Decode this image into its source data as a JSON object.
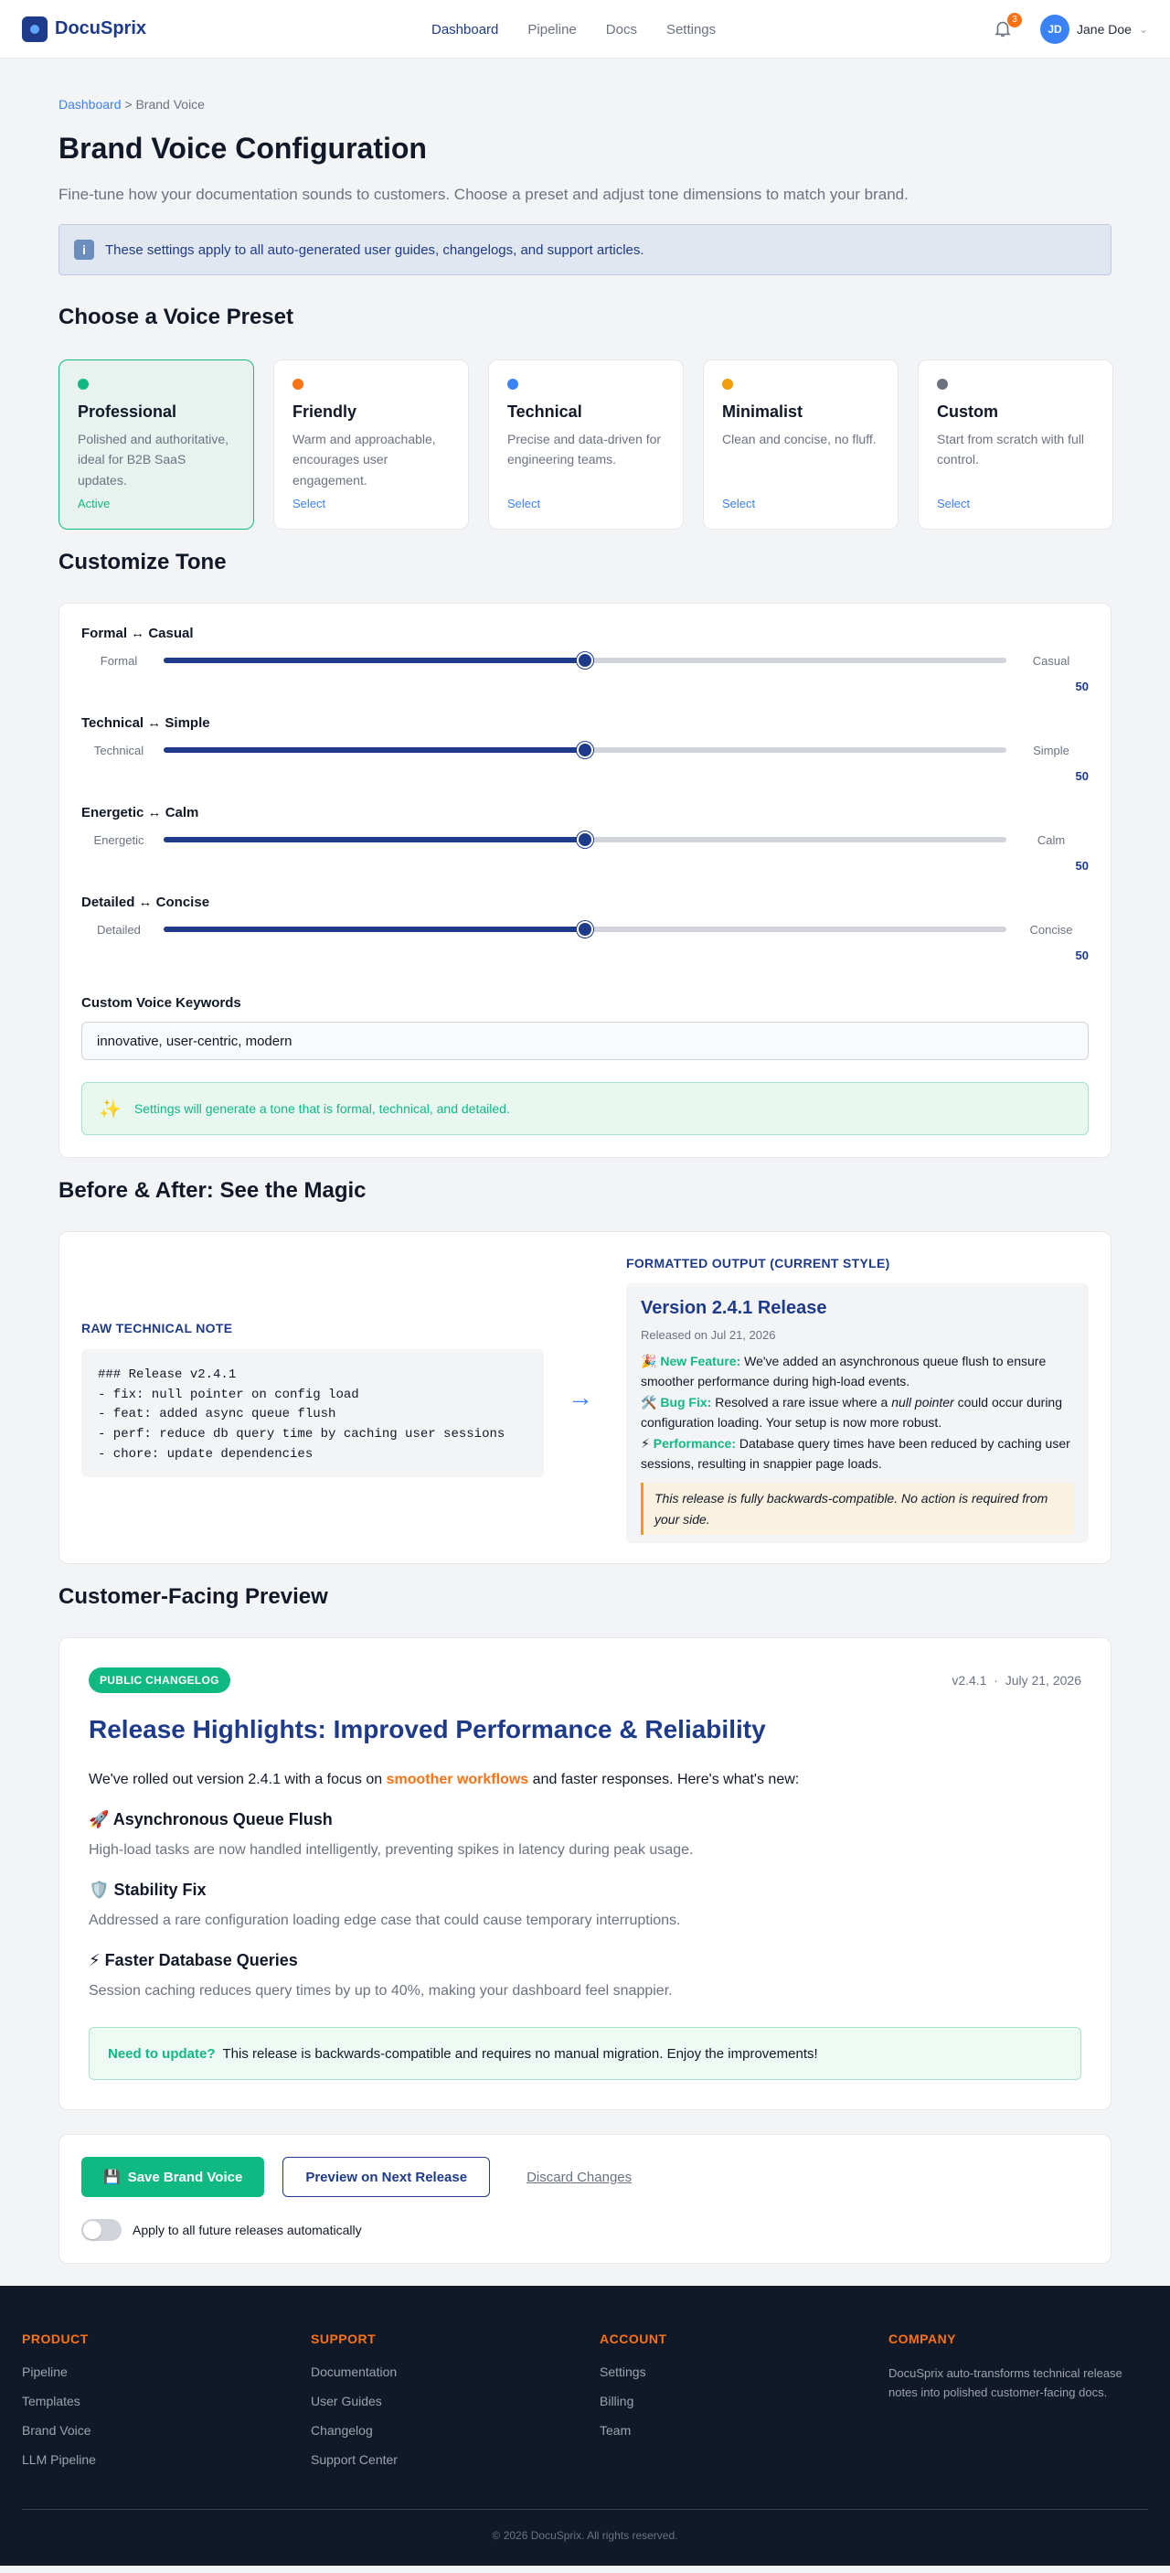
{
  "app": {
    "name": "DocuSprix"
  },
  "nav": {
    "items": [
      "Dashboard",
      "Pipeline",
      "Docs",
      "Settings"
    ],
    "active": "Dashboard"
  },
  "header": {
    "notification_count": "3",
    "user_initials": "JD",
    "user_name": "Jane Doe"
  },
  "breadcrumb": {
    "parent": "Dashboard",
    "separator": " > ",
    "current": "Brand Voice"
  },
  "page": {
    "title": "Brand Voice Configuration",
    "subtitle": "Fine-tune how your documentation sounds to customers. Choose a preset and adjust tone dimensions to match your brand.",
    "info": "These settings apply to all auto-generated user guides, changelogs, and support articles."
  },
  "presets": {
    "title": "Choose a Voice Preset",
    "items": [
      {
        "name": "Professional",
        "desc": "Polished and authoritative, ideal for B2B SaaS updates.",
        "action": "Active",
        "color": "#10b981",
        "active": true
      },
      {
        "name": "Friendly",
        "desc": "Warm and approachable, encourages user engagement.",
        "action": "Select",
        "color": "#f97316",
        "active": false
      },
      {
        "name": "Technical",
        "desc": "Precise and data-driven for engineering teams.",
        "action": "Select",
        "color": "#3b82f6",
        "active": false
      },
      {
        "name": "Minimalist",
        "desc": "Clean and concise, no fluff.",
        "action": "Select",
        "color": "#f59e0b",
        "active": false
      },
      {
        "name": "Custom",
        "desc": "Start from scratch with full control.",
        "action": "Select",
        "color": "#6b7280",
        "active": false
      }
    ]
  },
  "tone": {
    "title": "Customize Tone",
    "sliders": [
      {
        "title": "Formal ↔ Casual",
        "left": "Formal",
        "right": "Casual",
        "value": 50
      },
      {
        "title": "Technical ↔ Simple",
        "left": "Technical",
        "right": "Simple",
        "value": 50
      },
      {
        "title": "Energetic ↔ Calm",
        "left": "Energetic",
        "right": "Calm",
        "value": 50
      },
      {
        "title": "Detailed ↔ Concise",
        "left": "Detailed",
        "right": "Concise",
        "value": 50
      }
    ],
    "keywords_label": "Custom Voice Keywords",
    "keywords_value": "innovative, user-centric, modern",
    "summary": "Settings will generate a tone that is formal, technical, and detailed."
  },
  "before_after": {
    "title": "Before & After: See the Magic",
    "raw_label": "RAW TECHNICAL NOTE",
    "raw_lines": [
      "### Release v2.4.1",
      "- fix: null pointer on config load",
      "- feat: added async queue flush",
      "- perf: reduce db query time by caching user sessions",
      "- chore: update dependencies"
    ],
    "formatted_label": "FORMATTED OUTPUT (CURRENT STYLE)",
    "formatted_title": "Version 2.4.1 Release",
    "formatted_date": "Released on Jul 21, 2026",
    "feature_tag": "New Feature:",
    "feature_text": "We've added an asynchronous queue flush to ensure smoother performance during high-load events.",
    "fix_tag": "Bug Fix:",
    "fix_text_1": "Resolved a rare issue where a",
    "fix_text_em": "null pointer",
    "fix_text_2": "could occur during configuration loading. Your setup is now more robust.",
    "perf_tag": "Performance:",
    "perf_text": "Database query times have been reduced by caching user sessions, resulting in snappier page loads.",
    "note": "This release is fully backwards-compatible. No action is required from your side."
  },
  "preview": {
    "title": "Customer-Facing Preview",
    "badge": "PUBLIC CHANGELOG",
    "version": "v2.4.1",
    "meta_sep": "·",
    "date": "July 21, 2026",
    "headline": "Release Highlights: Improved Performance & Reliability",
    "intro_before": "We've rolled out version 2.4.1 with a focus on",
    "intro_highlight": "smoother workflows",
    "intro_after": "and faster responses. Here's what's new:",
    "items": [
      {
        "emoji": "🚀",
        "title": "Asynchronous Queue Flush",
        "desc": "High-load tasks are now handled intelligently, preventing spikes in latency during peak usage."
      },
      {
        "emoji": "🛡️",
        "title": "Stability Fix",
        "desc": "Addressed a rare configuration loading edge case that could cause temporary interruptions."
      },
      {
        "emoji": "⚡",
        "title": "Faster Database Queries",
        "desc": "Session caching reduces query times by up to 40%, making your dashboard feel snappier."
      }
    ],
    "callout_label": "Need to update?",
    "callout_text": "This release is backwards-compatible and requires no manual migration. Enjoy the improvements!"
  },
  "actions": {
    "save": "Save Brand Voice",
    "preview": "Preview on Next Release",
    "discard": "Discard Changes",
    "toggle_label": "Apply to all future releases automatically",
    "toggle_on": false
  },
  "footer": {
    "columns": [
      {
        "heading": "PRODUCT",
        "links": [
          "Pipeline",
          "Templates",
          "Brand Voice",
          "LLM Pipeline"
        ]
      },
      {
        "heading": "SUPPORT",
        "links": [
          "Documentation",
          "User Guides",
          "Changelog",
          "Support Center"
        ]
      },
      {
        "heading": "ACCOUNT",
        "links": [
          "Settings",
          "Billing",
          "Team"
        ]
      }
    ],
    "company_heading": "COMPANY",
    "company_desc": "DocuSprix auto-transforms technical release notes into polished customer-facing docs.",
    "copyright": "© 2026 DocuSprix. All rights reserved."
  }
}
